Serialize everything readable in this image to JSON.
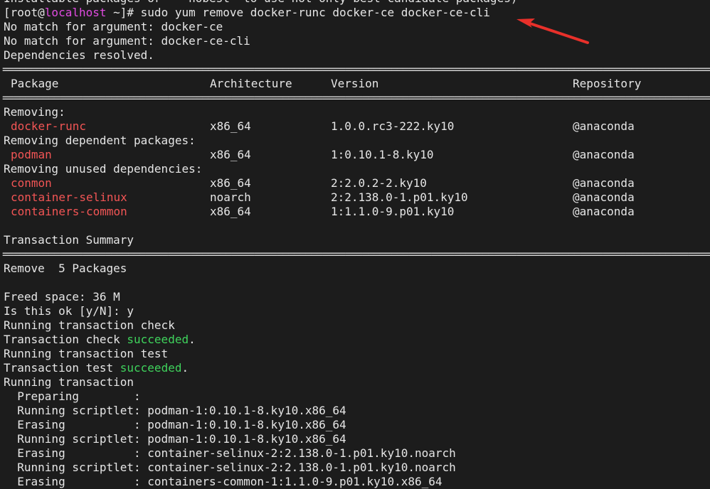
{
  "lines": {
    "l0": "Installable packages or '--nobest' to use not only best candidate packages)",
    "prompt_user": "[root@",
    "prompt_host": "localhost",
    "prompt_rest": " ~]# sudo yum remove docker-runc docker-ce docker-ce-cli",
    "l2": "No match for argument: docker-ce",
    "l3": "No match for argument: docker-ce-cli",
    "l4": "Dependencies resolved.",
    "separator": "================================================================================================================================================================================================",
    "h_package": "Package",
    "h_arch": "Architecture",
    "h_version": "Version",
    "h_repo": "Repository",
    "removing": "Removing:",
    "removing_dep": "Removing dependent packages:",
    "removing_unused": "Removing unused dependencies:",
    "txn_summary": "Transaction Summary",
    "remove_count": "Remove  5 Packages",
    "freed": "Freed space: 36 M",
    "is_ok": "Is this ok [y/N]: y",
    "run_check": "Running transaction check",
    "check_pre": "Transaction check ",
    "check_ok": "succeeded",
    "dot": ".",
    "run_test": "Running transaction test",
    "test_pre": "Transaction test ",
    "test_ok": "succeeded",
    "running": "Running transaction",
    "step1": "  Preparing        :",
    "step2": "  Running scriptlet: podman-1:0.10.1-8.ky10.x86_64",
    "step3": "  Erasing          : podman-1:0.10.1-8.ky10.x86_64",
    "step4": "  Running scriptlet: podman-1:0.10.1-8.ky10.x86_64",
    "step5": "  Erasing          : container-selinux-2:2.138.0-1.p01.ky10.noarch",
    "step6": "  Running scriptlet: container-selinux-2:2.138.0-1.p01.ky10.noarch",
    "step7": "  Erasing          : containers-common-1:1.1.0-9.p01.ky10.x86_64"
  },
  "packages": [
    {
      "name": "docker-runc",
      "arch": "x86_64",
      "version": "1.0.0.rc3-222.ky10",
      "repo": "@anaconda"
    },
    {
      "name": "podman",
      "arch": "x86_64",
      "version": "1:0.10.1-8.ky10",
      "repo": "@anaconda"
    },
    {
      "name": "conmon",
      "arch": "x86_64",
      "version": "2:2.0.2-2.ky10",
      "repo": "@anaconda"
    },
    {
      "name": "container-selinux",
      "arch": "noarch",
      "version": "2:2.138.0-1.p01.ky10",
      "repo": "@anaconda"
    },
    {
      "name": "containers-common",
      "arch": "x86_64",
      "version": "1:1.1.0-9.p01.ky10",
      "repo": "@anaconda"
    }
  ],
  "colors": {
    "background": "#1c1c1c",
    "text": "#e6e6e6",
    "package_name": "#f25555",
    "success": "#3fd35c",
    "hostname": "#e04be0",
    "annotation_arrow": "#e8302a"
  },
  "annotation": {
    "icon": "arrow-icon"
  }
}
